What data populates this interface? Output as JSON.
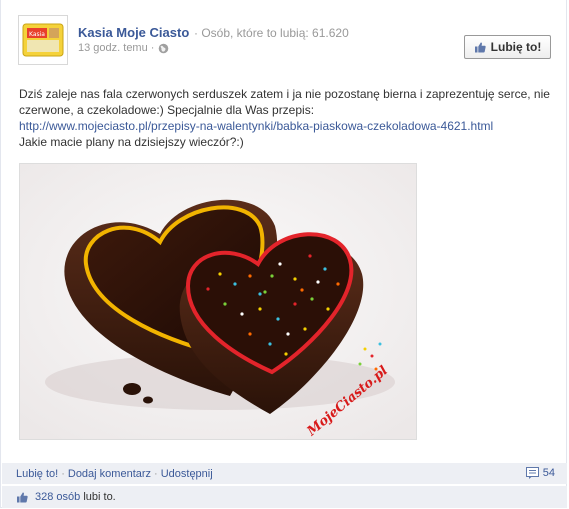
{
  "page": {
    "name": "Kasia Moje Ciasto",
    "likes_text": "· Osób, które to lubią: 61.620",
    "time_text": "13 godz. temu ·",
    "like_button_label": "Lubię to!"
  },
  "post": {
    "text_line1": "Dziś zaleje nas fala czerwonych serduszek zatem i ja nie pozostanę bierna i zaprezentuję serce, nie czerwone, a czekoladowe:) Specjalnie dla Was przepis:",
    "link_text": "http://www.mojeciasto.pl/przepisy-na-walentynki/babka-piaskowa-czekoladowa-4621.html",
    "text_line3": "Jakie macie plany na dzisiejszy wieczór?:)",
    "photo_watermark": "MojeCiasto.pl",
    "avatar_label": "Kasia"
  },
  "actions": {
    "like": "Lubię to!",
    "comment": "Dodaj komentarz",
    "share": "Udostępnij",
    "comments_count": "54"
  },
  "likes_bar": {
    "count_link": "328 osób",
    "suffix": "lubi to."
  },
  "colors": {
    "link": "#3b5998",
    "bar_bg": "#edeff4",
    "muted": "#999999"
  },
  "icons": {
    "globe": "globe-icon",
    "thumb": "thumbs-up-icon",
    "comment": "comment-icon"
  }
}
